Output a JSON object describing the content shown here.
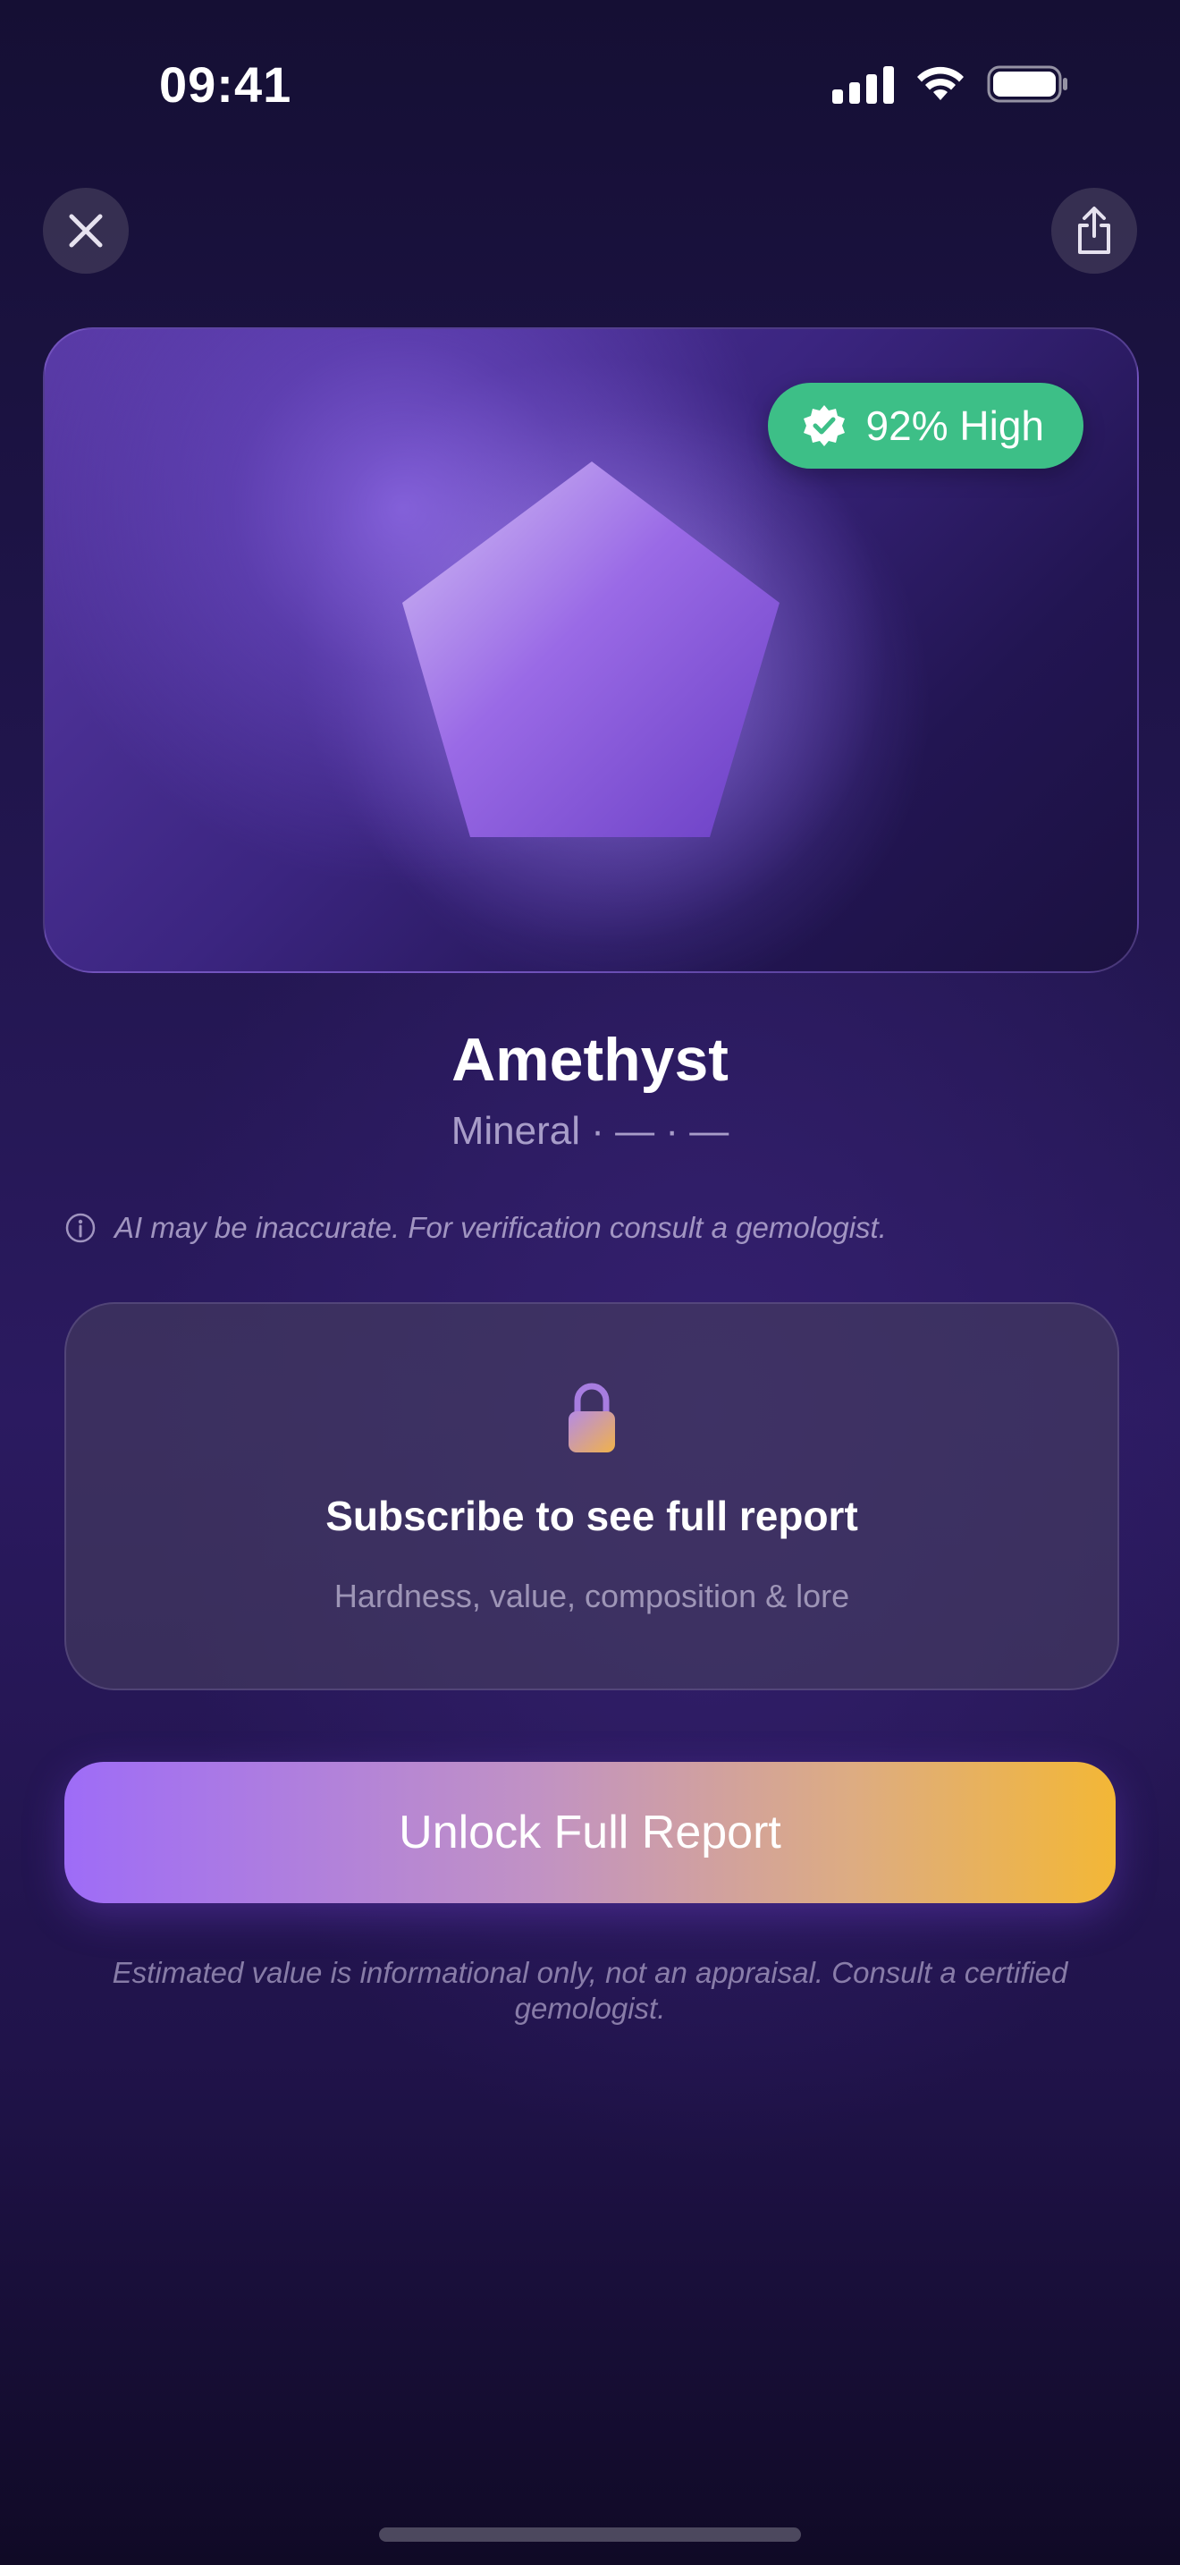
{
  "status_bar": {
    "time": "09:41"
  },
  "header": {
    "close_icon": "close-icon",
    "share_icon": "share-icon"
  },
  "hero": {
    "confidence_label": "92% High",
    "badge_color": "#3dbf87",
    "badge_icon": "verified-check-icon"
  },
  "gem": {
    "name": "Amethyst",
    "meta": "Mineral · — · —"
  },
  "ai_note": {
    "text": "AI may be inaccurate. For verification consult a gemologist."
  },
  "locked_card": {
    "title": "Subscribe to see full report",
    "subtitle": "Hardness, value, composition & lore"
  },
  "cta": {
    "label": "Unlock Full Report"
  },
  "disclaimer": {
    "text": "Estimated value is informational only, not an appraisal. Consult a certified gemologist."
  },
  "colors": {
    "accent_purple": "#9e6cf7",
    "accent_gold": "#f3b736",
    "badge_green": "#3dbf87"
  }
}
